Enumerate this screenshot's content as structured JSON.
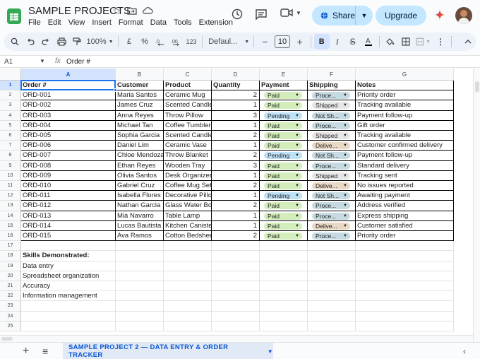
{
  "app": {
    "doc_title": "SAMPLE PROJECTS",
    "menu": [
      "File",
      "Edit",
      "View",
      "Insert",
      "Format",
      "Data",
      "Tools",
      "Extension"
    ],
    "share_label": "Share",
    "upgrade_label": "Upgrade"
  },
  "toolbar": {
    "zoom": "100%",
    "currency": "£",
    "percent": "%",
    "dec_decrease": ".0",
    "dec_increase": ".00",
    "number_format": "123",
    "font": "Defaul...",
    "font_size": "10"
  },
  "formula_bar": {
    "name_box": "A1",
    "fx": "fx",
    "value": "Order #"
  },
  "columns": [
    "A",
    "B",
    "C",
    "D",
    "E",
    "F",
    "G"
  ],
  "rows": [
    "1",
    "2",
    "3",
    "4",
    "5",
    "6",
    "7",
    "8",
    "9",
    "10",
    "11",
    "12",
    "13",
    "14",
    "15",
    "16",
    "17",
    "18",
    "19",
    "20",
    "21",
    "22",
    "23",
    "24",
    "25"
  ],
  "table": {
    "headers": [
      "Order #",
      "Customer",
      "Product",
      "Quantity",
      "Payment",
      "Shipping",
      "Notes"
    ],
    "data": [
      [
        "ORD-001",
        "Maria Santos",
        "Ceramic Mug",
        "2",
        "Paid",
        "Proce...",
        "Priority order"
      ],
      [
        "ORD-002",
        "James Cruz",
        "Scented Candle",
        "1",
        "Paid",
        "Shipped",
        "Tracking available"
      ],
      [
        "ORD-003",
        "Anna Reyes",
        "Throw Pillow",
        "3",
        "Pending",
        "Not Sh...",
        "Payment follow-up"
      ],
      [
        "ORD-004",
        "Michael Tan",
        "Coffee Tumbler",
        "1",
        "Paid",
        "Proce...",
        "Gift order"
      ],
      [
        "ORD-005",
        "Sophia Garcia",
        "Scented Candle",
        "2",
        "Paid",
        "Shipped",
        "Tracking available"
      ],
      [
        "ORD-006",
        "Daniel Lim",
        "Ceramic Vase",
        "1",
        "Paid",
        "Delive...",
        "Customer confirmed delivery"
      ],
      [
        "ORD-007",
        "Chloe Mendoza",
        "Throw Blanket",
        "2",
        "Pending",
        "Not Sh...",
        "Payment follow-up"
      ],
      [
        "ORD-008",
        "Ethan Reyes",
        "Wooden Tray",
        "3",
        "Paid",
        "Proce...",
        "Standard delivery"
      ],
      [
        "ORD-009",
        "Olivia Santos",
        "Desk Organizer",
        "1",
        "Paid",
        "Shipped",
        "Tracking sent"
      ],
      [
        "ORD-010",
        "Gabriel Cruz",
        "Coffee Mug Set",
        "2",
        "Paid",
        "Delive...",
        "No issues reported"
      ],
      [
        "ORD-011",
        "Isabella Flores",
        "Decorative Pillow",
        "1",
        "Pending",
        "Not Sh...",
        "Awaiting payment"
      ],
      [
        "ORD-012",
        "Nathan Garcia",
        "Glass Water Bottle",
        "2",
        "Paid",
        "Proce...",
        "Address verified"
      ],
      [
        "ORD-013",
        "Mia Navarro",
        "Table Lamp",
        "1",
        "Paid",
        "Proce...",
        "Express shipping"
      ],
      [
        "ORD-014",
        "Lucas Bautista",
        "Kitchen Canister",
        "1",
        "Paid",
        "Delive...",
        "Customer satisfied"
      ],
      [
        "ORD-015",
        "Ava Ramos",
        "Cotton Bedsheet",
        "2",
        "Paid",
        "Proce...",
        "Priority order"
      ]
    ]
  },
  "skills": {
    "title": "Skills Demonstrated:",
    "items": [
      "Data entry",
      "Spreadsheet organization",
      "Accuracy",
      "Information management"
    ]
  },
  "status_colors": {
    "Paid": "#d4edbc",
    "Pending": "#bfe1f6",
    "Proce...": "#c6dbe1",
    "Shipped": "#e6e6e6",
    "Not Sh...": "#c6dbe1",
    "Delive...": "#e8d8c4"
  },
  "sheet_tab": {
    "name": "SAMPLE PROJECT 2 — DATA ENTRY & ORDER TRACKER"
  }
}
